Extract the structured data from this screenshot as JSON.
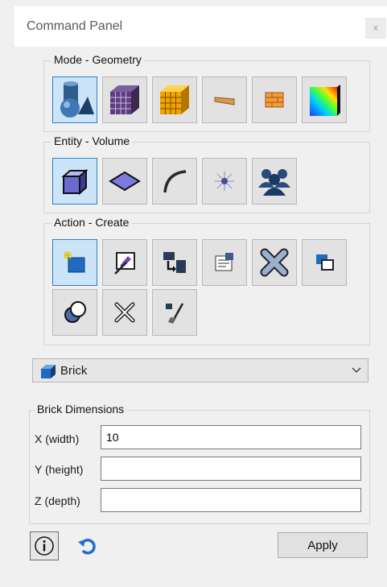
{
  "window": {
    "title": "Command Panel",
    "close_glyph": "x"
  },
  "mode_group": {
    "label": "Mode - Geometry",
    "buttons": [
      {
        "name": "geometry-mode-icon",
        "selected": true
      },
      {
        "name": "mesh-mode-icon",
        "selected": false
      },
      {
        "name": "boundary-conditions-mode-icon",
        "selected": false
      },
      {
        "name": "material-mode-icon",
        "selected": false
      },
      {
        "name": "analysis-mode-icon",
        "selected": false
      },
      {
        "name": "results-contour-mode-icon",
        "selected": false
      }
    ]
  },
  "entity_group": {
    "label": "Entity - Volume",
    "buttons": [
      {
        "name": "volume-entity-icon",
        "selected": true
      },
      {
        "name": "surface-entity-icon",
        "selected": false
      },
      {
        "name": "curve-entity-icon",
        "selected": false
      },
      {
        "name": "vertex-entity-icon",
        "selected": false
      },
      {
        "name": "group-entity-icon",
        "selected": false
      }
    ]
  },
  "action_group": {
    "label": "Action - Create",
    "buttons": [
      {
        "name": "create-action-icon",
        "selected": true
      },
      {
        "name": "modify-action-icon",
        "selected": false
      },
      {
        "name": "transform-action-icon",
        "selected": false
      },
      {
        "name": "properties-action-icon",
        "selected": false
      },
      {
        "name": "delete-action-icon",
        "selected": false
      },
      {
        "name": "copy-action-icon",
        "selected": false
      },
      {
        "name": "boolean-action-icon",
        "selected": false
      },
      {
        "name": "decompose-action-icon",
        "selected": false
      },
      {
        "name": "cleanup-action-icon",
        "selected": false
      }
    ]
  },
  "shape_select": {
    "value": "Brick",
    "icon": "brick-cube-icon"
  },
  "dimensions": {
    "label": "Brick Dimensions",
    "fields": [
      {
        "label": "X (width)",
        "value": "10"
      },
      {
        "label": "Y (height)",
        "value": ""
      },
      {
        "label": "Z (depth)",
        "value": ""
      }
    ]
  },
  "footer": {
    "apply_label": "Apply",
    "info_icon": "info-icon",
    "reset_icon": "reset-icon"
  },
  "colors": {
    "selected_bg": "#cce4f7",
    "selected_border": "#2d7fcb",
    "reset_blue": "#1e6fd0"
  }
}
